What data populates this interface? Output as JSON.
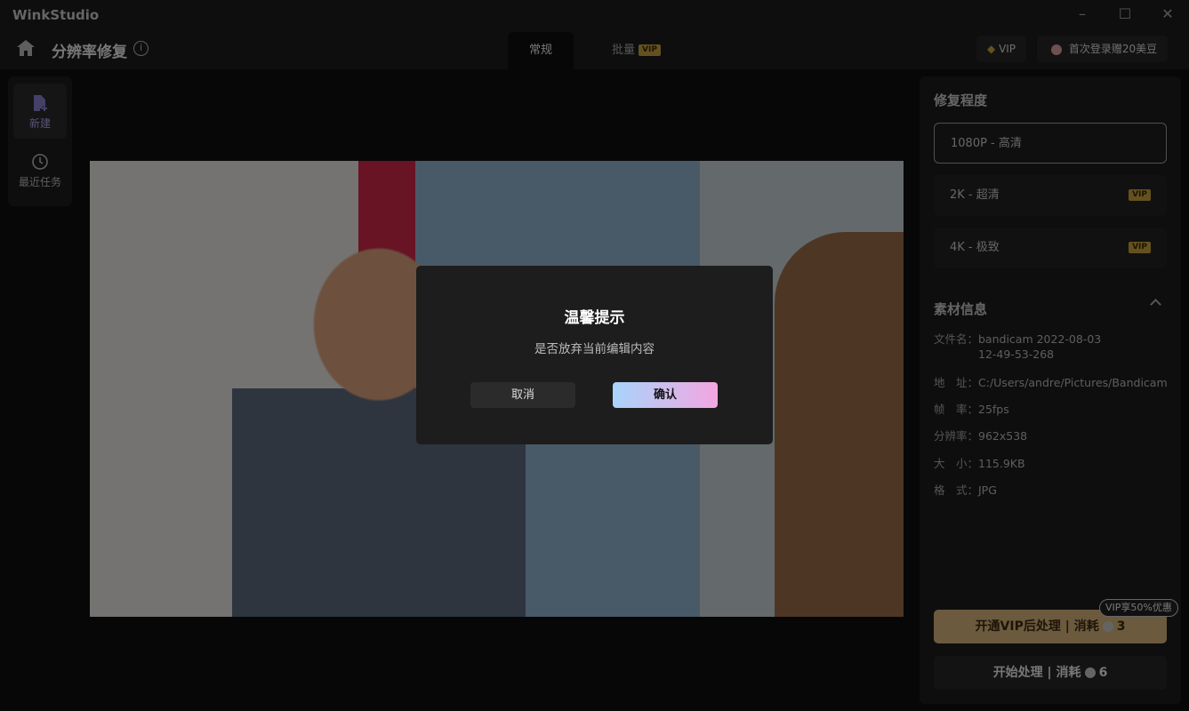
{
  "app": {
    "title": "WinkStudio",
    "window_controls": [
      "minimize",
      "maximize",
      "close"
    ]
  },
  "header": {
    "title": "分辨率修复",
    "tabs": [
      {
        "label": "常规",
        "active": true
      },
      {
        "label": "批量",
        "badge": "VIP"
      }
    ],
    "vip_label": "VIP",
    "promo_label": "首次登录赠20美豆"
  },
  "sidebar": {
    "items": [
      {
        "label": "新建",
        "icon": "new-file-icon",
        "active": true
      },
      {
        "label": "最近任务",
        "icon": "history-icon"
      }
    ]
  },
  "panel": {
    "repair_title": "修复程度",
    "options": [
      {
        "label": "1080P - 高清",
        "selected": true
      },
      {
        "label": "2K - 超清",
        "badge": "VIP"
      },
      {
        "label": "4K - 极致",
        "badge": "VIP"
      }
    ],
    "info_title": "素材信息",
    "info": [
      {
        "key": "文件名：",
        "value": "bandicam 2022-08-03 12-49-53-268"
      },
      {
        "key": "地　址：",
        "value": "C:/Users/andre/Pictures/Bandicam"
      },
      {
        "key": "帧　率：",
        "value": "25fps"
      },
      {
        "key": "分辨率：",
        "value": "962x538"
      },
      {
        "key": "大　小：",
        "value": "115.9KB"
      },
      {
        "key": "格　式：",
        "value": "JPG"
      }
    ],
    "vip_tip": "VIP享50%优惠",
    "vip_button": {
      "label": "开通VIP后处理 | 消耗",
      "cost": "3"
    },
    "start_button": {
      "label": "开始处理 | 消耗",
      "cost": "6"
    }
  },
  "dialog": {
    "title": "温馨提示",
    "message": "是否放弃当前编辑内容",
    "cancel": "取消",
    "confirm": "确认"
  },
  "colors": {
    "accent_vip": "#d6b47a",
    "confirm_gradient_start": "#a8d4fb",
    "confirm_gradient_end": "#f3a6e0"
  }
}
